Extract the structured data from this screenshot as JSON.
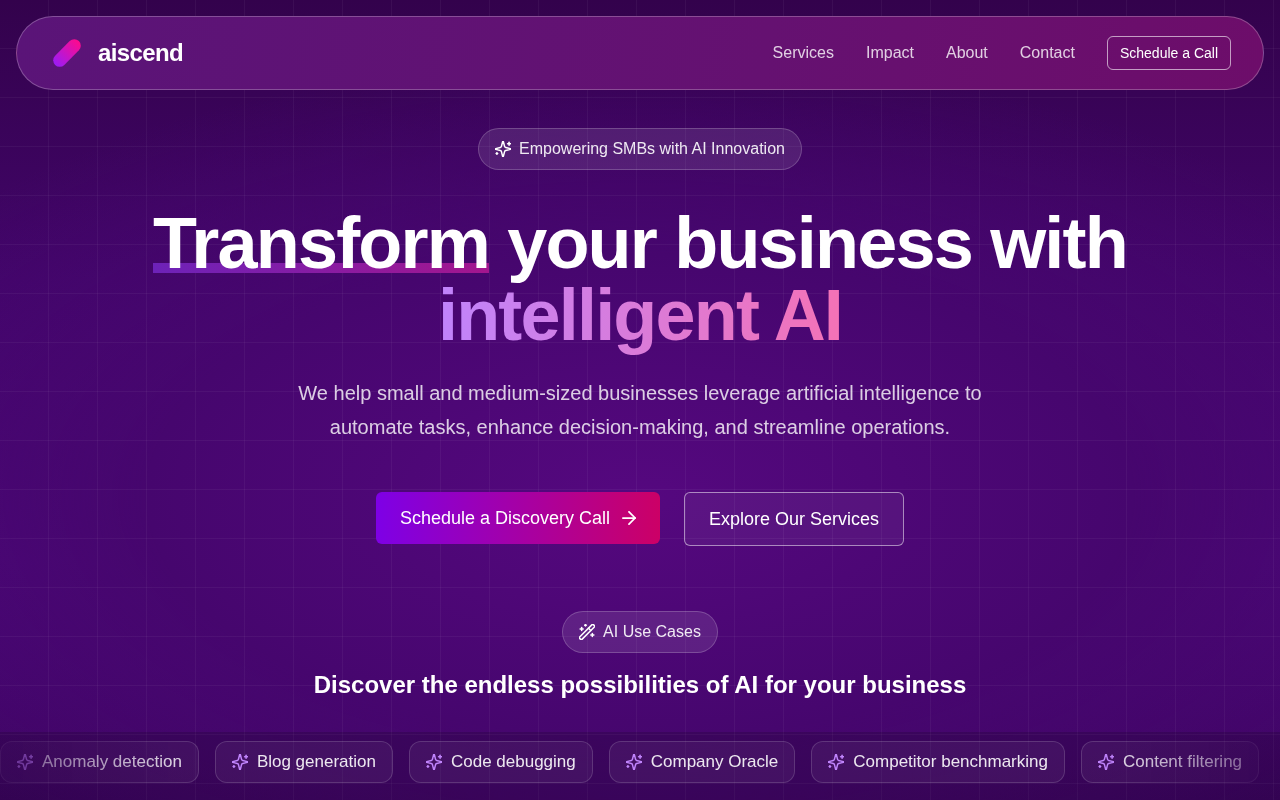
{
  "nav": {
    "logo": "aiscend",
    "links": [
      {
        "label": "Services"
      },
      {
        "label": "Impact"
      },
      {
        "label": "About"
      },
      {
        "label": "Contact"
      }
    ],
    "button": "Schedule a Call"
  },
  "hero": {
    "badge": "Empowering SMBs with AI Innovation",
    "heading": [
      {
        "kind": "underlined",
        "text": "Transform"
      },
      {
        "kind": "plain",
        "text": "your business with"
      },
      {
        "kind": "gradient",
        "text": "intelligent AI"
      }
    ],
    "description": "We help small and medium-sized businesses leverage artificial intelligence to automate tasks, enhance decision-making, and streamline operations.",
    "buttons": [
      {
        "kind": "primary",
        "label": "Schedule a Discovery Call"
      },
      {
        "kind": "outline",
        "label": "Explore Our Services"
      }
    ]
  },
  "use_cases": {
    "badge": "AI Use Cases",
    "title": "Discover the endless possibilities of AI for your business",
    "chips": [
      {
        "label": "Anomaly detection"
      },
      {
        "label": "Blog generation"
      },
      {
        "label": "Code debugging"
      },
      {
        "label": "Company Oracle"
      },
      {
        "label": "Competitor benchmarking"
      },
      {
        "label": "Content filtering"
      }
    ]
  }
}
